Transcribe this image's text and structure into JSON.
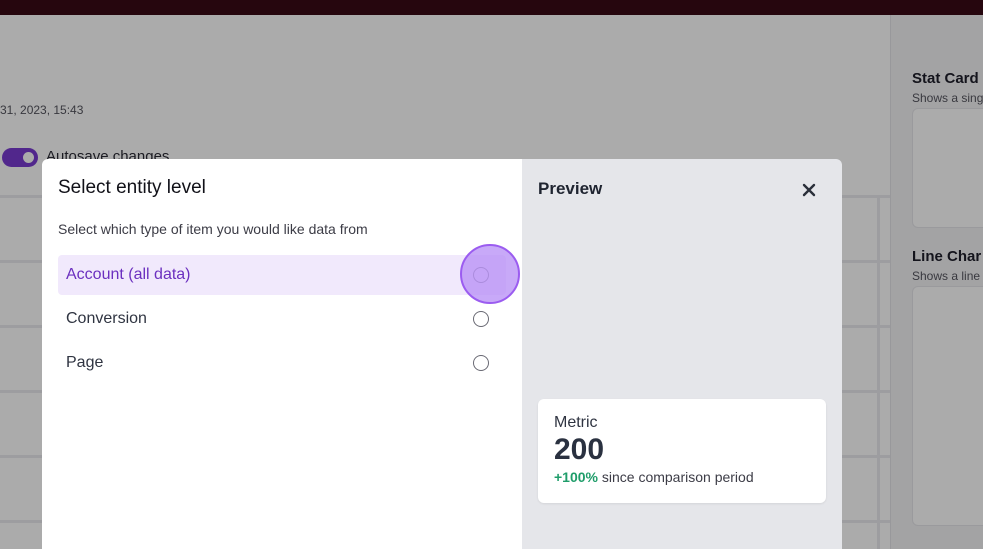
{
  "background": {
    "date_text": "31, 2023, 15:43",
    "autosave_label": "Autosave changes",
    "sidebar_cards": [
      {
        "title": "Stat Card",
        "subtitle": "Shows a sing"
      },
      {
        "title": "Line Char",
        "subtitle": "Shows a line"
      }
    ]
  },
  "modal": {
    "title": "Select entity level",
    "description": "Select which type of item you would like data from",
    "options": [
      {
        "label": "Account (all data)",
        "selected": true
      },
      {
        "label": "Conversion",
        "selected": false
      },
      {
        "label": "Page",
        "selected": false
      }
    ],
    "preview": {
      "title": "Preview",
      "close_icon": "close-icon",
      "stat": {
        "label": "Metric",
        "value": "200",
        "change": "+100%",
        "change_suffix": "since comparison period"
      }
    }
  },
  "colors": {
    "accent": "#6b2fbf",
    "selected_bg": "#f1e9fc",
    "positive": "#1f9d6a",
    "topbar": "#3a0a16"
  }
}
